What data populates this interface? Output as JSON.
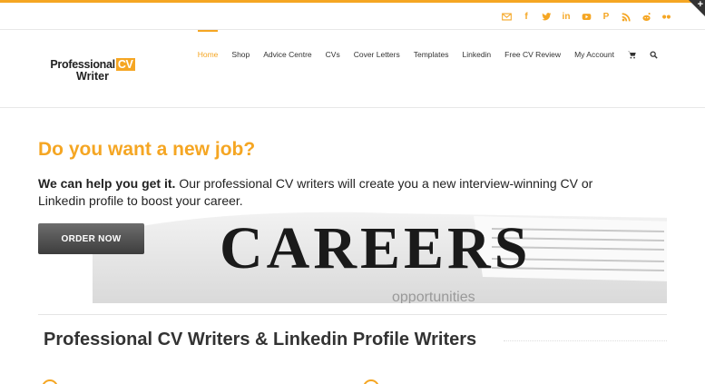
{
  "social": {
    "icons": [
      "envelope-icon",
      "facebook-icon",
      "twitter-icon",
      "linkedin-icon",
      "youtube-icon",
      "pinterest-icon",
      "rss-icon",
      "reddit-icon",
      "flickr-icon"
    ]
  },
  "brand": {
    "line1": "Professional",
    "cv": "CV",
    "line2": "Writer",
    "accent": "#f5a623"
  },
  "nav": {
    "items": [
      {
        "label": "Home",
        "active": true
      },
      {
        "label": "Shop"
      },
      {
        "label": "Advice Centre"
      },
      {
        "label": "CVs"
      },
      {
        "label": "Cover Letters"
      },
      {
        "label": "Templates"
      },
      {
        "label": "Linkedin"
      },
      {
        "label": "Free CV Review"
      },
      {
        "label": "My Account"
      }
    ],
    "cart_icon": "cart-icon",
    "search_icon": "search-icon"
  },
  "hero": {
    "title": "Do you want a new job?",
    "bold_text": "We can help you get it.",
    "text": " Our professional CV writers will create you a new interview-winning CV or Linkedin profile to boost your career.",
    "button": "ORDER NOW",
    "paper_word": "CAREERS",
    "paper_word2": "opportunities"
  },
  "section": {
    "title": "Professional CV Writers & Linkedin Profile Writers"
  }
}
